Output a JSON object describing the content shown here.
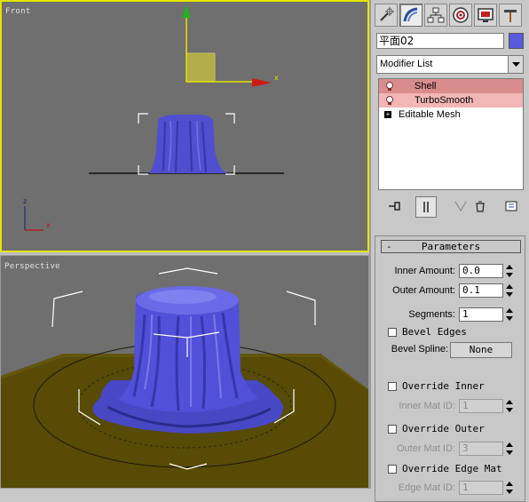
{
  "viewports": {
    "front": {
      "label": "Front"
    },
    "perspective": {
      "label": "Perspective"
    },
    "axis": {
      "x": "x",
      "z": "z"
    }
  },
  "command_panel": {
    "tabs": [
      "create-icon",
      "modify-icon",
      "hierarchy-icon",
      "motion-icon",
      "display-icon",
      "utilities-icon"
    ],
    "active_tab": "modify-icon",
    "object_name": "平面02",
    "object_color": "#5a5adc",
    "modifier_list": "Modifier List",
    "stack": [
      {
        "label": "Shell",
        "state": "selected"
      },
      {
        "label": "TurboSmooth",
        "state": "active"
      },
      {
        "label": "Editable Mesh",
        "state": "base"
      }
    ],
    "plus_sign": "+",
    "parameters": {
      "title": "Parameters",
      "collapse": "-",
      "inner_amount_label": "Inner Amount:",
      "inner_amount": "0.0",
      "outer_amount_label": "Outer Amount:",
      "outer_amount": "0.1",
      "segments_label": "Segments:",
      "segments": "1",
      "bevel_edges": "Bevel Edges",
      "bevel_spline_label": "Bevel Spline:",
      "bevel_spline_value": "None",
      "override_inner": "Override Inner",
      "inner_mat_id_label": "Inner Mat ID:",
      "inner_mat_id": "1",
      "override_outer": "Override Outer",
      "outer_mat_id_label": "Outer Mat ID:",
      "outer_mat_id": "3",
      "override_edge_mat": "Override Edge Mat",
      "edge_mat_id_label": "Edge Mat ID:",
      "edge_mat_id": "1"
    }
  }
}
